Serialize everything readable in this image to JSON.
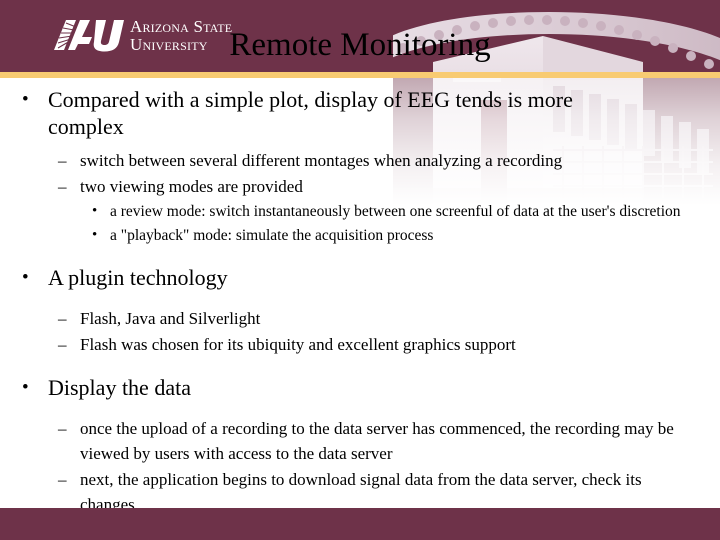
{
  "theme": {
    "maroon": "#6E3249",
    "gold": "#F8CB72",
    "body_text": "#000000",
    "background": "#FFFFFF"
  },
  "header": {
    "logo": {
      "mark_text": "ASU",
      "line1": "Arizona State",
      "line2": "University"
    },
    "title": "Remote Monitoring",
    "watermark": "asu-gammage-building-photo"
  },
  "content": {
    "blocks": [
      {
        "level": 1,
        "marker": "•",
        "text": "Compared with a simple plot, display of EEG tends is more complex"
      },
      {
        "level": 2,
        "marker": "–",
        "text": "switch between several different montages when analyzing a recording"
      },
      {
        "level": 2,
        "marker": "–",
        "text": "two viewing modes are provided"
      },
      {
        "level": 3,
        "marker": "•",
        "text": "a review mode: switch instantaneously between one screenful of data at the user's discretion"
      },
      {
        "level": 3,
        "marker": "•",
        "text": "a \"playback\" mode: simulate the acquisition process"
      },
      {
        "level": 1,
        "marker": "•",
        "text": "A plugin technology"
      },
      {
        "level": 2,
        "marker": "–",
        "text": "Flash, Java and Silverlight"
      },
      {
        "level": 2,
        "marker": "–",
        "text": "Flash was chosen for its ubiquity and excellent graphics support"
      },
      {
        "level": 1,
        "marker": "•",
        "text": "Display the data"
      },
      {
        "level": 2,
        "marker": "–",
        "text": "once the upload of a recording to the data server has commenced, the recording may be viewed by users with access to the data server"
      },
      {
        "level": 2,
        "marker": "–",
        "text": "next, the application begins to download signal data from the data server, check its changes"
      }
    ]
  },
  "footer": {
    "label": ""
  }
}
